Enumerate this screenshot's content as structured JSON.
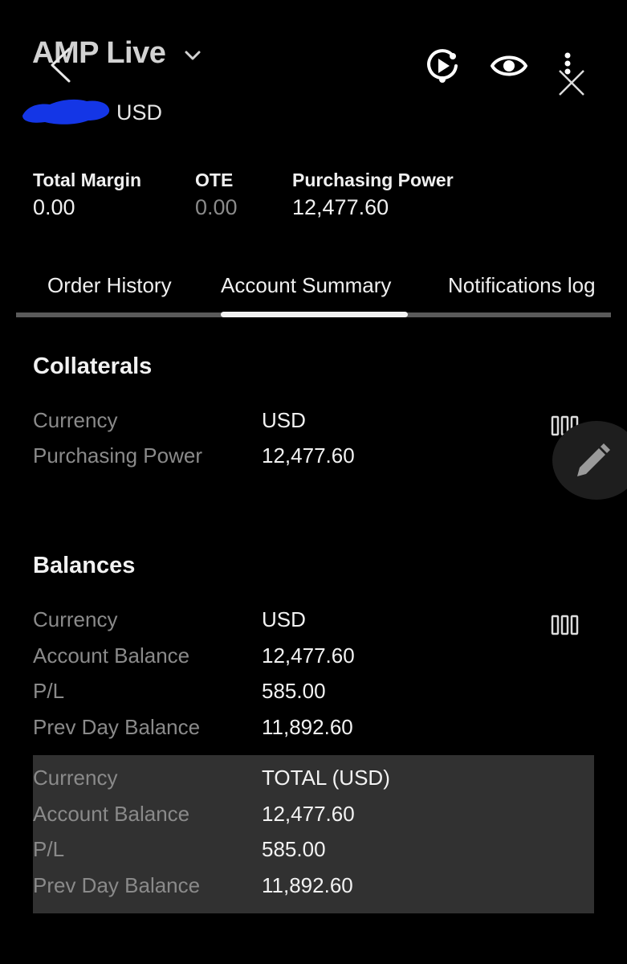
{
  "header": {
    "title": "AMP Live",
    "currency": "USD"
  },
  "stats": [
    {
      "label": "Total Margin",
      "value": "0.00"
    },
    {
      "label": "OTE",
      "value": "0.00"
    },
    {
      "label": "Purchasing Power",
      "value": "12,477.60"
    }
  ],
  "tabs": [
    {
      "label": "Order History"
    },
    {
      "label": "Account Summary",
      "active": true
    },
    {
      "label": "Notifications log"
    }
  ],
  "collaterals": {
    "title": "Collaterals",
    "rows": [
      {
        "label": "Currency",
        "value": "USD"
      },
      {
        "label": "Purchasing Power",
        "value": "12,477.60"
      }
    ]
  },
  "balances": {
    "title": "Balances",
    "rows": [
      {
        "label": "Currency",
        "value": "USD"
      },
      {
        "label": "Account Balance",
        "value": "12,477.60"
      },
      {
        "label": "P/L",
        "value": "585.00"
      },
      {
        "label": "Prev Day Balance",
        "value": "11,892.60"
      }
    ],
    "total_rows": [
      {
        "label": "Currency",
        "value": "TOTAL (USD)"
      },
      {
        "label": "Account Balance",
        "value": "12,477.60"
      },
      {
        "label": "P/L",
        "value": "585.00"
      },
      {
        "label": "Prev Day Balance",
        "value": "11,892.60"
      }
    ]
  },
  "colors": {
    "background": "#000000",
    "muted_text": "#8a8a8a",
    "total_row_bg": "#313131",
    "redaction": "#1436e6"
  },
  "icons": [
    "chevron-down-icon",
    "back-arrow-icon",
    "replay-icon",
    "eye-icon",
    "more-vertical-icon",
    "close-icon",
    "columns-icon",
    "pencil-icon"
  ]
}
